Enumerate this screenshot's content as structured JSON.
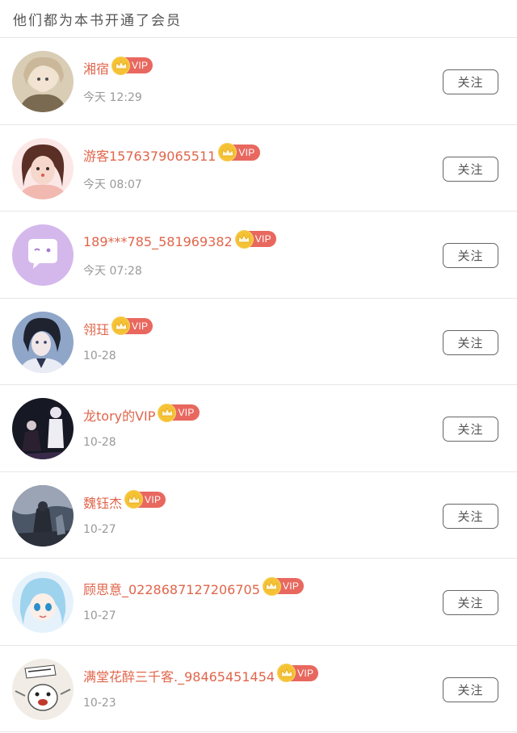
{
  "header": {
    "title": "他们都为本书开通了会员"
  },
  "vip_label": "VIP",
  "follow_label": "关注",
  "colors": {
    "name": "#e0654b",
    "vip_badge": "#e8685f",
    "crown": "#f5c233",
    "time": "#999999"
  },
  "members": [
    {
      "name": "湘宿",
      "time": "今天 12:29",
      "avatar": "girl-illustration-avatar"
    },
    {
      "name": "游客1576379065511",
      "time": "今天 08:07",
      "avatar": "selfie-filter-avatar"
    },
    {
      "name": "189***785_581969382",
      "time": "今天 07:28",
      "avatar": "default-chat-avatar"
    },
    {
      "name": "翎珏",
      "time": "10-28",
      "avatar": "anime-boy-avatar"
    },
    {
      "name": "龙tory的VIP",
      "time": "10-28",
      "avatar": "dark-photo-avatar"
    },
    {
      "name": "魏钰杰",
      "time": "10-27",
      "avatar": "dark-fantasy-avatar"
    },
    {
      "name": "顾思意_0228687127206705",
      "time": "10-27",
      "avatar": "blue-hair-anime-avatar"
    },
    {
      "name": "满堂花醉三千客._98465451454",
      "time": "10-23",
      "avatar": "comic-meme-avatar"
    }
  ]
}
